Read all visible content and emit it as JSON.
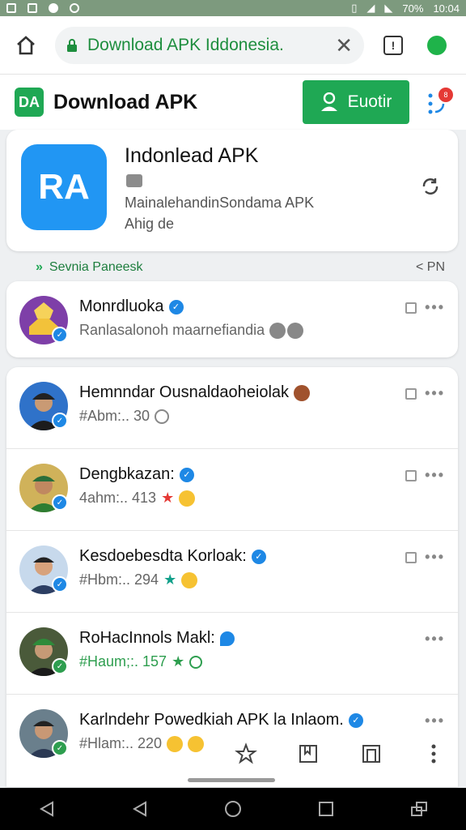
{
  "statusbar": {
    "time": "10:04",
    "battery": "70%"
  },
  "browser": {
    "url": "Download APK Iddonesia.",
    "home_icon": "home-icon",
    "lock_icon": "lock-icon",
    "clear_icon": "close-icon",
    "tabs_label": "!",
    "profile_color": "#1fb34a"
  },
  "app": {
    "title": "Download APK",
    "logo_text": "DA",
    "login_label": "Euotir",
    "notif_count": "8"
  },
  "featured": {
    "icon_text": "RA",
    "title": "Indonlead APK",
    "description": "MainalehandinSondama APK",
    "subtitle": "Ahig de"
  },
  "section": {
    "title": "Sevnia Paneesk",
    "right_label": "< PN"
  },
  "items": [
    {
      "name": "Monrdluoka",
      "meta": "Ranlasalonoh maarnefiandia",
      "badge_color": "#1e88e5",
      "avatar_bg": "#7e3fa8"
    },
    {
      "name": "Hemnndar Ousnaldaoheiolak",
      "meta": "#Abm:.. 30",
      "badge_color": "#1e88e5",
      "avatar_bg": "#2f72c9"
    },
    {
      "name": "Dengbkazan:",
      "meta": "4ahm:.. 413",
      "badge_color": "#1e88e5",
      "avatar_bg": "#d0b25a"
    },
    {
      "name": "Kesdoebesdta Korloak:",
      "meta": "#Hbm:.. 294",
      "badge_color": "#1e88e5",
      "avatar_bg": "#c7d9ec"
    },
    {
      "name": "RoHacInnols Makl:",
      "meta": "#Haum;:. 157",
      "badge_color": "#2e9e4f",
      "avatar_bg": "#4a5a3a"
    },
    {
      "name": "Karlndehr Powedkiah APK la Inlaom.",
      "meta": "#Hlam:.. 220",
      "badge_color": "#2e9e4f",
      "avatar_bg": "#6a7f8c"
    }
  ],
  "colors": {
    "accent": "#1fa854",
    "blue": "#2196f3",
    "verified": "#1e88e5"
  }
}
